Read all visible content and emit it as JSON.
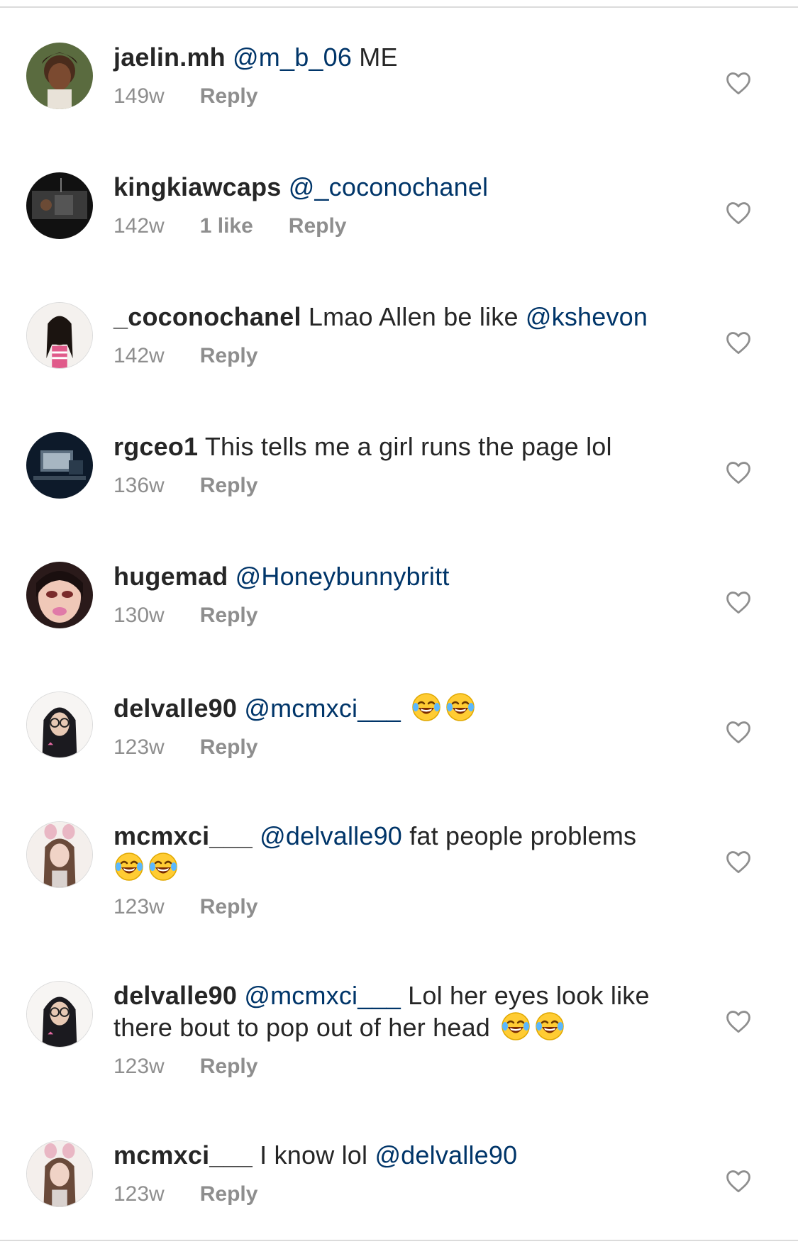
{
  "comments": [
    {
      "username": "jaelin.mh",
      "mentions_before": [
        "@m_b_06"
      ],
      "text": "ME",
      "age": "149w",
      "likes": "",
      "reply_label": "Reply",
      "emojis": [],
      "avatar": "avatar-photo-smiling-woman"
    },
    {
      "username": "kingkiawcaps",
      "mentions_before": [
        "@_coconochanel"
      ],
      "text": "",
      "age": "142w",
      "likes": "1 like",
      "reply_label": "Reply",
      "emojis": [],
      "avatar": "avatar-photo-dark-room"
    },
    {
      "username": "_coconochanel",
      "text": "Lmao Allen be like",
      "mention_after": "@kshevon",
      "age": "142w",
      "likes": "",
      "reply_label": "Reply",
      "emojis": [],
      "avatar": "avatar-photo-braids"
    },
    {
      "username": "rgceo1",
      "text": "This tells me a girl runs the page lol",
      "age": "136w",
      "likes": "",
      "reply_label": "Reply",
      "emojis": [],
      "avatar": "avatar-photo-desk-setup"
    },
    {
      "username": "hugemad",
      "mentions_before": [
        "@Honeybunnybritt"
      ],
      "text": "",
      "age": "130w",
      "likes": "",
      "reply_label": "Reply",
      "emojis": [],
      "avatar": "avatar-doll-face"
    },
    {
      "username": "delvalle90",
      "mentions_before": [
        "@mcmxci___"
      ],
      "text": "",
      "age": "123w",
      "likes": "",
      "reply_label": "Reply",
      "emojis": [
        "😂",
        "😂"
      ],
      "avatar": "avatar-glasses-filter"
    },
    {
      "username": "mcmxci___",
      "mentions_before": [
        "@delvalle90"
      ],
      "text": "fat people problems",
      "age": "123w",
      "likes": "",
      "reply_label": "Reply",
      "emojis": [
        "😂",
        "😂"
      ],
      "avatar": "avatar-bunny-filter"
    },
    {
      "username": "delvalle90",
      "mentions_before": [
        "@mcmxci___"
      ],
      "text": "Lol her eyes look like there bout to pop out of her head",
      "age": "123w",
      "likes": "",
      "reply_label": "Reply",
      "emojis": [
        "😂",
        "😂"
      ],
      "avatar": "avatar-glasses-filter"
    },
    {
      "username": "mcmxci___",
      "text": "I know lol",
      "mention_after": "@delvalle90",
      "age": "123w",
      "likes": "",
      "reply_label": "Reply",
      "emojis": [],
      "avatar": "avatar-bunny-filter"
    }
  ],
  "colors": {
    "text": "#262626",
    "mention": "#003569",
    "meta": "#8e8e8e",
    "divider": "#dbdbdb"
  }
}
